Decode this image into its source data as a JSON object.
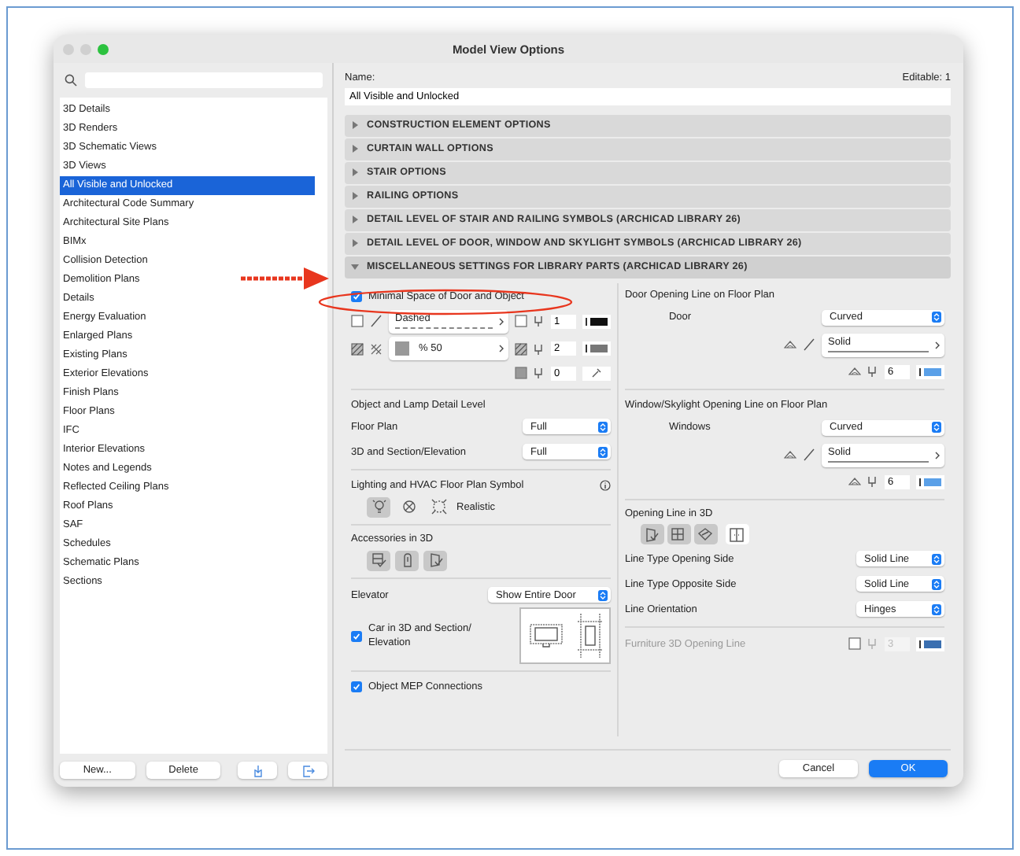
{
  "window": {
    "title": "Model View Options"
  },
  "sidebar": {
    "items": [
      {
        "label": "3D Details",
        "selected": false
      },
      {
        "label": "3D Renders",
        "selected": false
      },
      {
        "label": "3D Schematic Views",
        "selected": false
      },
      {
        "label": "3D Views",
        "selected": false
      },
      {
        "label": "All Visible and Unlocked",
        "selected": true
      },
      {
        "label": "Architectural Code Summary",
        "selected": false
      },
      {
        "label": "Architectural Site Plans",
        "selected": false
      },
      {
        "label": "BIMx",
        "selected": false
      },
      {
        "label": "Collision Detection",
        "selected": false
      },
      {
        "label": "Demolition Plans",
        "selected": false
      },
      {
        "label": "Details",
        "selected": false
      },
      {
        "label": "Energy Evaluation",
        "selected": false
      },
      {
        "label": "Enlarged Plans",
        "selected": false
      },
      {
        "label": "Existing Plans",
        "selected": false
      },
      {
        "label": "Exterior Elevations",
        "selected": false
      },
      {
        "label": "Finish Plans",
        "selected": false
      },
      {
        "label": "Floor Plans",
        "selected": false
      },
      {
        "label": "IFC",
        "selected": false
      },
      {
        "label": "Interior Elevations",
        "selected": false
      },
      {
        "label": "Notes and Legends",
        "selected": false
      },
      {
        "label": "Reflected Ceiling Plans",
        "selected": false
      },
      {
        "label": "Roof Plans",
        "selected": false
      },
      {
        "label": "SAF",
        "selected": false
      },
      {
        "label": "Schedules",
        "selected": false
      },
      {
        "label": "Schematic Plans",
        "selected": false
      },
      {
        "label": "Sections",
        "selected": false
      }
    ],
    "buttons": [
      {
        "label": "New..."
      },
      {
        "label": "Delete"
      }
    ]
  },
  "name": {
    "label": "Name:",
    "value": "All Visible and Unlocked",
    "editable": "Editable: 1"
  },
  "sections": [
    {
      "label": "CONSTRUCTION ELEMENT OPTIONS",
      "expanded": false
    },
    {
      "label": "CURTAIN WALL OPTIONS",
      "expanded": false
    },
    {
      "label": "STAIR OPTIONS",
      "expanded": false
    },
    {
      "label": "RAILING OPTIONS",
      "expanded": false
    },
    {
      "label": "DETAIL LEVEL OF STAIR AND RAILING SYMBOLS (ARCHICAD LIBRARY 26)",
      "expanded": false
    },
    {
      "label": "DETAIL LEVEL OF DOOR, WINDOW AND SKYLIGHT SYMBOLS (ARCHICAD LIBRARY 26)",
      "expanded": false
    },
    {
      "label": "MISCELLANEOUS SETTINGS FOR LIBRARY PARTS (ARCHICAD LIBRARY 26)",
      "expanded": true
    }
  ],
  "library_parts": {
    "left": {
      "minimal_space": {
        "label": "Minimal Space of Door and Object",
        "checked": true
      },
      "line": {
        "value": "Dashed",
        "pen": "1"
      },
      "fill": {
        "value": "% 50",
        "pen": "2"
      },
      "background_pen": "0",
      "detail_level": {
        "title": "Object and Lamp Detail Level",
        "fields": [
          {
            "label": "Floor Plan",
            "value": "Full"
          },
          {
            "label": "3D and Section/Elevation",
            "value": "Full"
          }
        ]
      },
      "lighting": {
        "title": "Lighting and HVAC Floor Plan Symbol",
        "options": [
          {
            "kind": "bulb",
            "selected": true
          },
          {
            "kind": "cross",
            "selected": false
          },
          {
            "kind": "ring",
            "selected": false
          }
        ],
        "option_label": "Realistic"
      },
      "accessories": {
        "title": "Accessories in 3D",
        "options": [
          {
            "kind": "panel",
            "selected": true
          },
          {
            "kind": "hand",
            "selected": true
          },
          {
            "kind": "door",
            "selected": true
          }
        ]
      },
      "elevator": {
        "label": "Elevator",
        "value": "Show Entire Door"
      },
      "car": {
        "label": "Car in 3D and Section/ Elevation",
        "checked": true
      },
      "mep": {
        "label": "Object MEP Connections",
        "checked": true
      }
    },
    "right": {
      "door": {
        "title": "Door Opening Line on Floor Plan",
        "label": "Door",
        "value": "Curved",
        "line": "Solid",
        "pen": "6"
      },
      "window": {
        "title": "Window/Skylight Opening Line on Floor Plan",
        "label": "Windows",
        "value": "Curved",
        "line": "Solid",
        "pen": "6"
      },
      "opening_3d": {
        "title": "Opening Line in 3D",
        "options": [
          {
            "kind": "door",
            "selected": true
          },
          {
            "kind": "window",
            "selected": true
          },
          {
            "kind": "skylight",
            "selected": true
          },
          {
            "kind": "cabinet",
            "selected": false
          }
        ],
        "fields": [
          {
            "label": "Line Type Opening Side",
            "value": "Solid Line"
          },
          {
            "label": "Line Type Opposite Side",
            "value": "Solid Line"
          },
          {
            "label": "Line Orientation",
            "value": "Hinges"
          }
        ]
      },
      "furniture": {
        "label": "Furniture 3D Opening Line",
        "pen": "3",
        "disabled": true
      }
    }
  },
  "footer": {
    "buttons": [
      {
        "label": "Cancel",
        "kind": "default"
      },
      {
        "label": "OK",
        "kind": "primary"
      }
    ]
  }
}
